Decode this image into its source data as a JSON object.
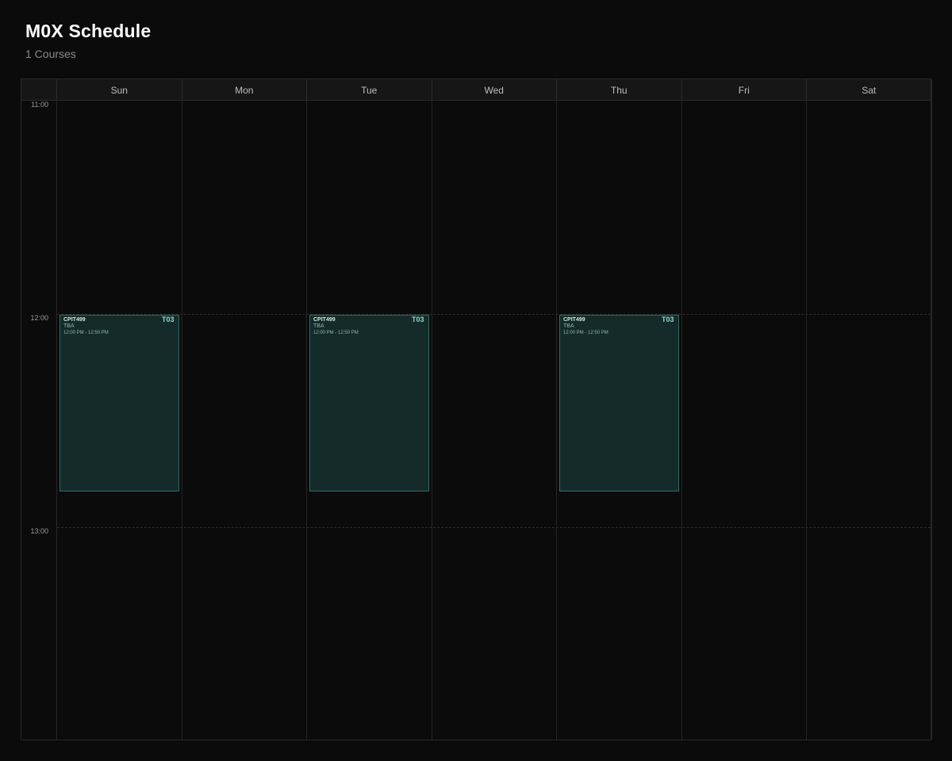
{
  "page": {
    "title": "M0X Schedule",
    "subtitle": "1 Courses"
  },
  "days": [
    "Sun",
    "Mon",
    "Tue",
    "Wed",
    "Thu",
    "Fri",
    "Sat"
  ],
  "hours": [
    "11:00",
    "12:00",
    "13:00"
  ],
  "events": [
    {
      "day": "Sun",
      "course": "CPIT499",
      "section": "T03",
      "location": "TBA",
      "time": "12:00 PM - 12:50 PM"
    },
    {
      "day": "Tue",
      "course": "CPIT499",
      "section": "T03",
      "location": "TBA",
      "time": "12:00 PM - 12:50 PM"
    },
    {
      "day": "Thu",
      "course": "CPIT499",
      "section": "T03",
      "location": "TBA",
      "time": "12:00 PM - 12:50 PM"
    }
  ],
  "colors": {
    "background": "#0b0b0b",
    "event_fill": "#142b29",
    "event_border": "#2e6e63",
    "section_text": "#7fe0cf"
  }
}
